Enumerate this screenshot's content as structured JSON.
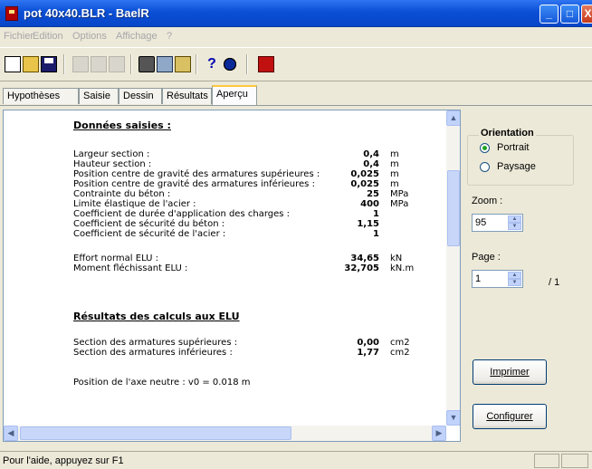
{
  "window": {
    "title": "pot 40x40.BLR - BaelR",
    "min": "_",
    "max": "□",
    "close": "X"
  },
  "menu": [
    "Fichier",
    "Edition",
    "Options",
    "Affichage",
    "?"
  ],
  "toolbar": {
    "icons": [
      "new-file-icon",
      "open-folder-icon",
      "save-disk-icon",
      "cut-icon",
      "copy-icon",
      "paste-icon",
      "print-icon",
      "print-preview-icon",
      "page-setup-icon",
      "help-icon",
      "about-icon",
      "calculator-icon"
    ],
    "help_glyph": "?"
  },
  "tabs": [
    "Hypothèses",
    "Saisie",
    "Dessin",
    "Résultats",
    "Aperçu"
  ],
  "active_tab": "Aperçu",
  "preview": {
    "section1_title": "Données saisies :",
    "inputs": [
      {
        "label": "Largeur section :",
        "value": "0,4",
        "unit": "m"
      },
      {
        "label": "Hauteur section :",
        "value": "0,4",
        "unit": "m"
      },
      {
        "label": "Position centre de gravité des armatures supérieures :",
        "value": "0,025",
        "unit": "m"
      },
      {
        "label": "Position centre de gravité des armatures inférieures :",
        "value": "0,025",
        "unit": "m"
      },
      {
        "label": "Contrainte du béton :",
        "value": "25",
        "unit": "MPa"
      },
      {
        "label": "Limite élastique de l'acier :",
        "value": "400",
        "unit": "MPa"
      },
      {
        "label": "Coefficient de durée d'application des charges :",
        "value": "1",
        "unit": ""
      },
      {
        "label": "Coefficient de sécurité du béton :",
        "value": "1,15",
        "unit": ""
      },
      {
        "label": "Coefficient de sécurité de l'acier :",
        "value": "1",
        "unit": ""
      }
    ],
    "efforts": [
      {
        "label": "Effort normal ELU :",
        "value": "34,65",
        "unit": "kN"
      },
      {
        "label": "Moment fléchissant ELU :",
        "value": "32,705",
        "unit": "kN.m"
      }
    ],
    "section2_title": "Résultats des calculs aux ELU",
    "results": [
      {
        "label": "Section des armatures supérieures :",
        "value": "0,00",
        "unit": "cm2"
      },
      {
        "label": "Section des armatures inférieures :",
        "value": "1,77",
        "unit": "cm2"
      }
    ],
    "neutral_axis": "Position de l'axe neutre : v0 = 0.018 m"
  },
  "side": {
    "orientation_title": "Orientation",
    "portrait": "Portrait",
    "landscape": "Paysage",
    "selected": "Portrait",
    "zoom_label": "Zoom :",
    "zoom_value": "95",
    "page_label": "Page :",
    "page_value": "1",
    "page_total": "/ 1",
    "print_btn": "Imprimer",
    "config_btn": "Configurer"
  },
  "status": {
    "text": "Pour l'aide, appuyez sur F1"
  }
}
